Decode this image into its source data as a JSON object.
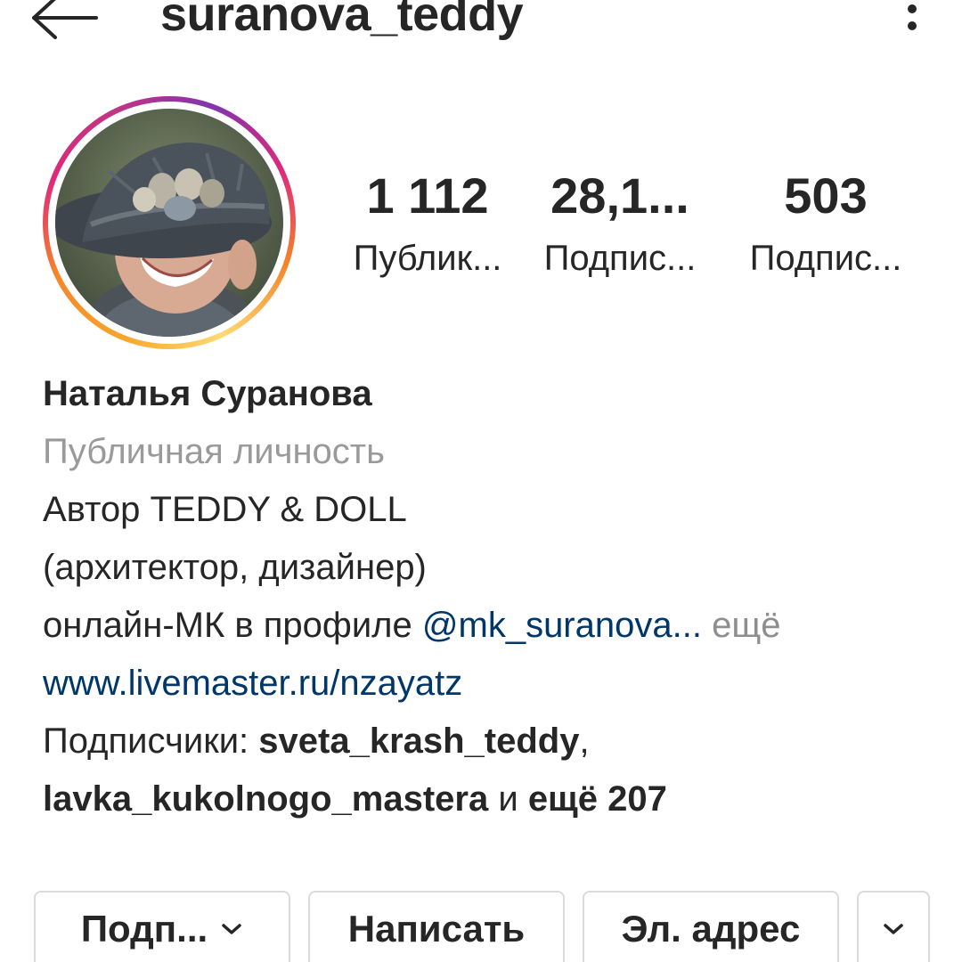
{
  "header": {
    "username": "suranova_teddy",
    "back_icon": "arrow-left-icon",
    "more_icon": "kebab-menu-icon"
  },
  "profile": {
    "avatar": "profile-photo-woman-in-hat-icon"
  },
  "stats": [
    {
      "value": "1 112",
      "label": "Публик..."
    },
    {
      "value": "28,1...",
      "label": "Подпис..."
    },
    {
      "value": "503",
      "label": "Подпис..."
    }
  ],
  "bio": {
    "name": "Наталья Суранова",
    "category": "Публичная личность",
    "line1": "Автор TEDDY & DOLL",
    "line2": "(архитектор, дизайнер)",
    "line3_prefix": "онлайн-МК в профиле ",
    "line3_mention": "@mk_suranova",
    "line3_ellipsis": "...",
    "line3_more": " ещё",
    "website": "www.livemaster.ru/nzayatz",
    "followed_prefix": "Подписчики: ",
    "followed_user1": "sveta_krash_teddy",
    "followed_comma": ",",
    "followed_user2": "lavka_kukolnogo_mastera",
    "followed_and": " и ",
    "followed_rest": "ещё 207"
  },
  "buttons": {
    "follow": "Подп...",
    "message": "Написать",
    "email": "Эл. адрес",
    "chevron_icon": "chevron-down-icon"
  },
  "colors": {
    "text": "#262626",
    "secondary": "#9a9a9a",
    "link": "#00376b",
    "border": "#dbdbdb",
    "story_ring": "#dd2a7b"
  }
}
